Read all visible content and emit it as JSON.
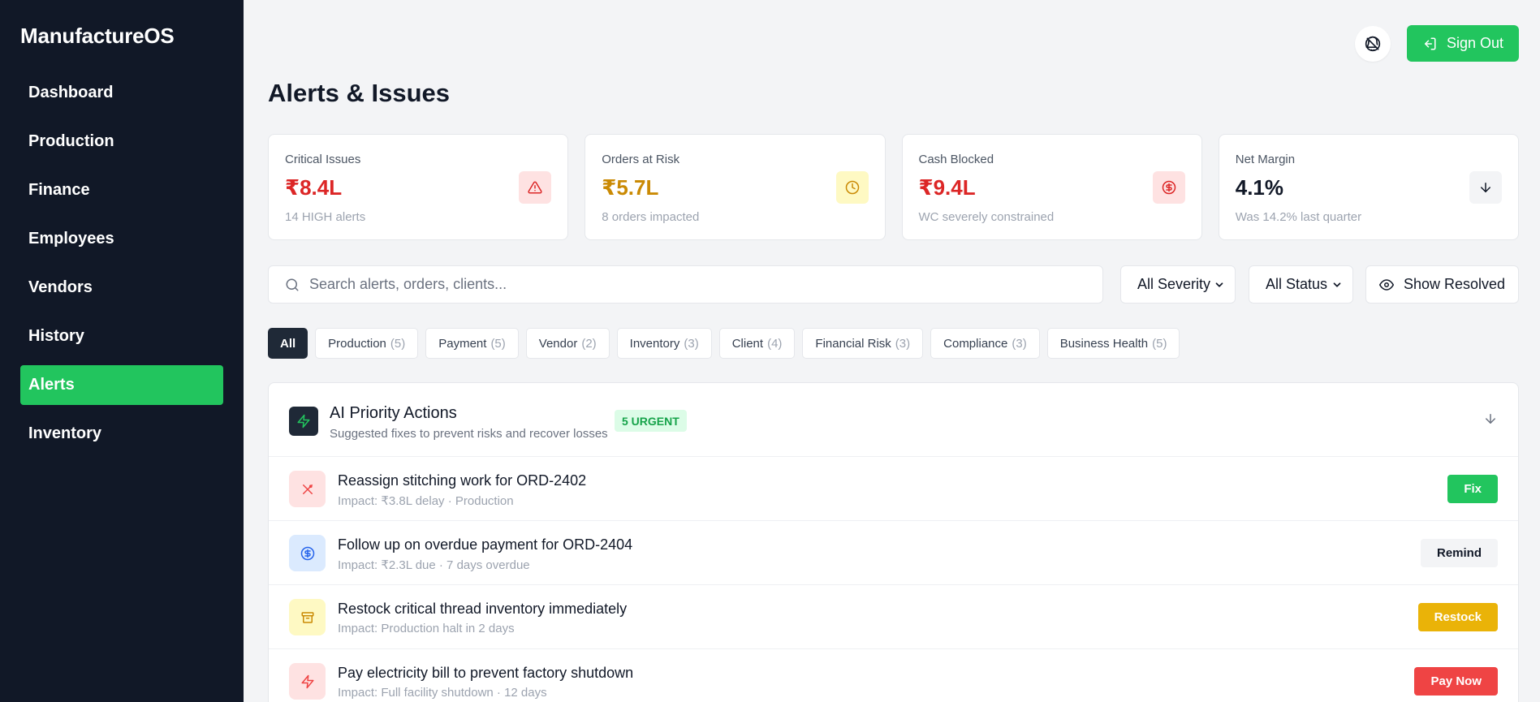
{
  "app": {
    "brand": "ManufactureOS"
  },
  "sidebar": {
    "items": [
      {
        "label": "Dashboard"
      },
      {
        "label": "Production"
      },
      {
        "label": "Finance"
      },
      {
        "label": "Employees"
      },
      {
        "label": "Vendors"
      },
      {
        "label": "History"
      },
      {
        "label": "Alerts",
        "active": true
      },
      {
        "label": "Inventory"
      }
    ]
  },
  "header": {
    "notification_icon": "bell-off-icon",
    "signout_label": "Sign Out",
    "page_title": "Alerts & Issues"
  },
  "stats": [
    {
      "label": "Critical Issues",
      "value": "₹8.4L",
      "sub": "14 HIGH alerts",
      "icon": "alert-triangle-icon",
      "color": "#dc2626",
      "icon_bg": "#fee2e2"
    },
    {
      "label": "Orders at Risk",
      "value": "₹5.7L",
      "sub": "8 orders impacted",
      "icon": "clock-icon",
      "color": "#ca8a04",
      "icon_bg": "#fef9c3"
    },
    {
      "label": "Cash Blocked",
      "value": "₹9.4L",
      "sub": "WC severely constrained",
      "icon": "dollar-circle-icon",
      "color": "#dc2626",
      "icon_bg": "#fee2e2"
    },
    {
      "label": "Net Margin",
      "value": "4.1%",
      "sub": "Was 14.2% last quarter",
      "icon": "arrow-down-icon",
      "color": "#111827",
      "icon_bg": "#f3f4f6"
    }
  ],
  "filters": {
    "search_placeholder": "Search alerts, orders, clients...",
    "severity_selected": "All Severity",
    "status_selected": "All Status",
    "show_resolved_label": "Show Resolved"
  },
  "chips": [
    {
      "label": "All",
      "count": "",
      "active": true
    },
    {
      "label": "Production",
      "count": "(5)"
    },
    {
      "label": "Payment",
      "count": "(5)"
    },
    {
      "label": "Vendor",
      "count": "(2)"
    },
    {
      "label": "Inventory",
      "count": "(3)"
    },
    {
      "label": "Client",
      "count": "(4)"
    },
    {
      "label": "Financial Risk",
      "count": "(3)"
    },
    {
      "label": "Compliance",
      "count": "(3)"
    },
    {
      "label": "Business Health",
      "count": "(5)"
    }
  ],
  "priority_panel": {
    "title": "AI Priority Actions",
    "subtitle": "Suggested fixes to prevent risks and recover losses",
    "badge": "5 URGENT",
    "actions": [
      {
        "title": "Reassign stitching work for ORD-2402",
        "impact": "Impact: ₹3.8L delay · Production",
        "button": "Fix",
        "icon": "tools-icon",
        "icon_color": "#ef4444",
        "icon_bg": "#fee2e2",
        "btn_bg": "#22c55e",
        "btn_color": "#ffffff"
      },
      {
        "title": "Follow up on overdue payment for ORD-2404",
        "impact": "Impact: ₹2.3L due · 7 days overdue",
        "button": "Remind",
        "icon": "dollar-circle-icon",
        "icon_color": "#2563eb",
        "icon_bg": "#dbeafe",
        "btn_bg": "#f3f4f6",
        "btn_color": "#111827"
      },
      {
        "title": "Restock critical thread inventory immediately",
        "impact": "Impact: Production halt in 2 days",
        "button": "Restock",
        "icon": "archive-icon",
        "icon_color": "#ca8a04",
        "icon_bg": "#fef9c3",
        "btn_bg": "#eab308",
        "btn_color": "#ffffff"
      },
      {
        "title": "Pay electricity bill to prevent factory shutdown",
        "impact": "Impact: Full facility shutdown · 12 days",
        "button": "Pay Now",
        "icon": "bolt-icon",
        "icon_color": "#ef4444",
        "icon_bg": "#fee2e2",
        "btn_bg": "#ef4444",
        "btn_color": "#ffffff"
      }
    ]
  }
}
